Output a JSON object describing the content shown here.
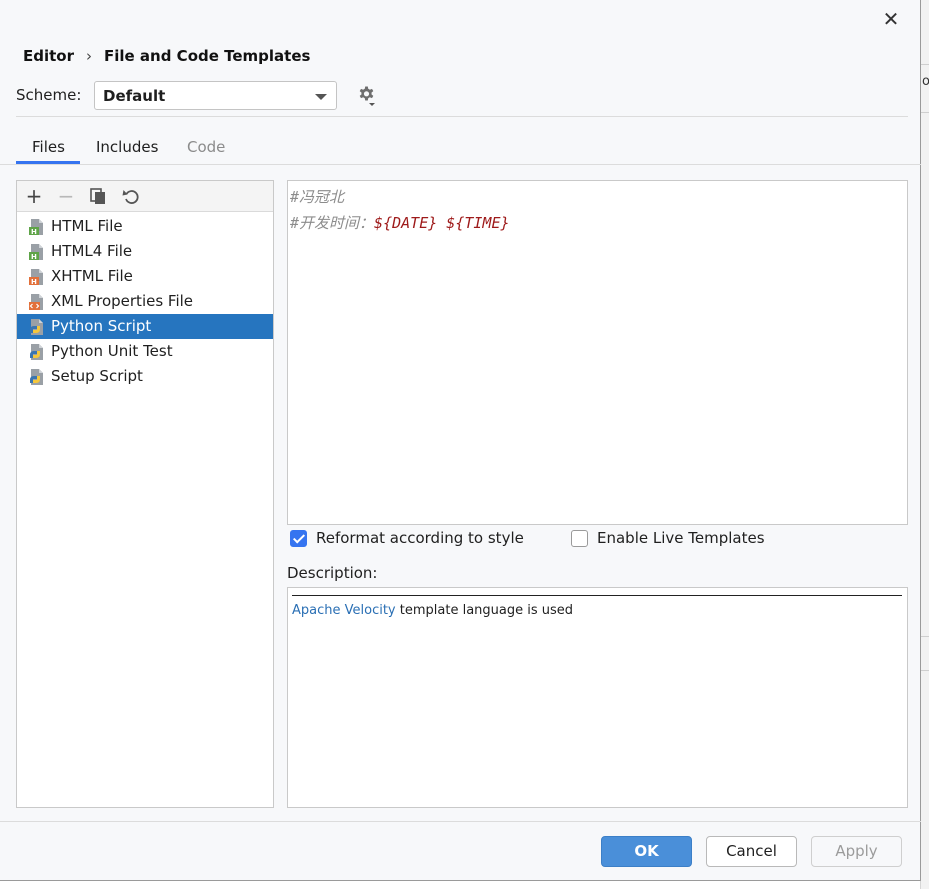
{
  "window": {
    "close_glyph": "✕"
  },
  "breadcrumb": {
    "parent": "Editor",
    "separator": "›",
    "current": "File and Code Templates"
  },
  "scheme": {
    "label": "Scheme:",
    "value": "Default"
  },
  "tabs": [
    {
      "label": "Files",
      "active": true
    },
    {
      "label": "Includes",
      "active": false
    },
    {
      "label": "Code",
      "active": false,
      "disabled": true
    }
  ],
  "toolbar": {
    "add": "+",
    "remove": "−",
    "reset_icon": "reset-icon",
    "copy_icon": "copy-icon"
  },
  "templates": [
    {
      "label": "HTML File",
      "icon": "html-file-icon"
    },
    {
      "label": "HTML4 File",
      "icon": "html-file-icon"
    },
    {
      "label": "XHTML File",
      "icon": "xhtml-file-icon"
    },
    {
      "label": "XML Properties File",
      "icon": "xml-file-icon"
    },
    {
      "label": "Python Script",
      "icon": "python-file-icon",
      "selected": true
    },
    {
      "label": "Python Unit Test",
      "icon": "python-file-icon"
    },
    {
      "label": "Setup Script",
      "icon": "python-file-icon"
    }
  ],
  "editor": {
    "lines": [
      {
        "hash": "#",
        "comment": "冯冠北"
      },
      {
        "hash": "#",
        "comment": "开发时间：",
        "date_var": "${DATE}",
        "space": " ",
        "time_var": "${TIME}"
      }
    ]
  },
  "options": {
    "reformat": {
      "label": "Reformat according to style",
      "checked": true
    },
    "live_templates": {
      "label": "Enable Live Templates",
      "checked": false
    }
  },
  "description": {
    "label": "Description:",
    "link": "Apache Velocity",
    "text": " template language is used"
  },
  "buttons": {
    "ok": "OK",
    "cancel": "Cancel",
    "apply": "Apply"
  },
  "colors": {
    "accent": "#3574f0",
    "selection": "#2675bf",
    "ok_button": "#4a8fd9",
    "velocity_var": "#9e1a1a",
    "comment": "#8c8c8c"
  }
}
